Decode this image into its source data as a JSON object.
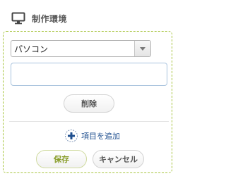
{
  "section": {
    "title": "制作環境",
    "icon": "monitor-icon"
  },
  "environment_select": {
    "selected": "パソコン",
    "arrow_icon": "dropdown-arrow-icon"
  },
  "item_input": {
    "value": "",
    "placeholder": ""
  },
  "buttons": {
    "delete_label": "削除",
    "save_label": "保存",
    "cancel_label": "キャンセル"
  },
  "add_item": {
    "label": "項目を追加",
    "icon": "plus-circle-icon"
  },
  "colors": {
    "panel_border": "#a6c43c",
    "save_text": "#8a9e2c",
    "link_text": "#1f4f8f",
    "input_border": "#a9c3dd",
    "plus_icon": "#1f4f8f"
  }
}
